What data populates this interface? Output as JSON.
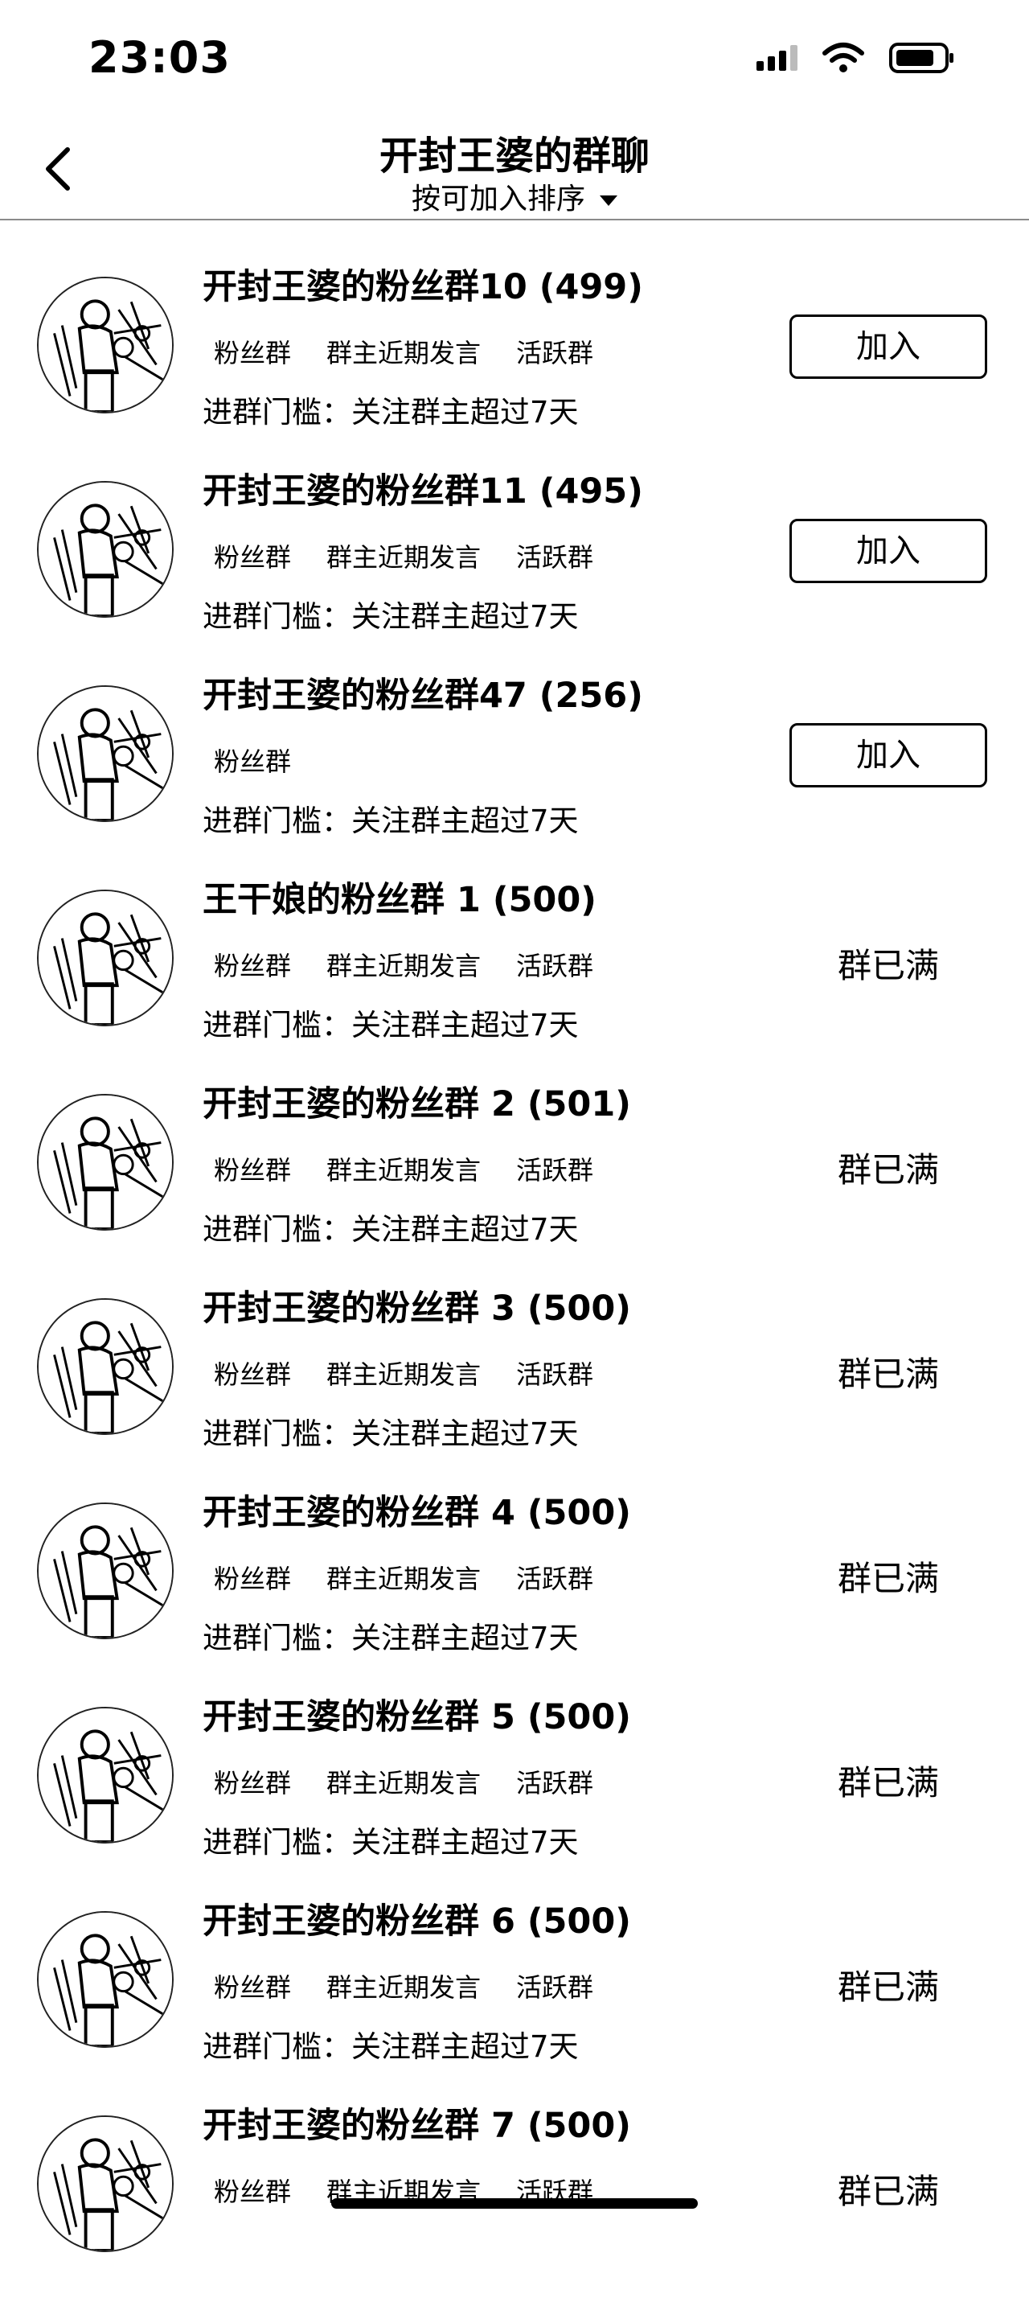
{
  "status_bar": {
    "time": "23:03"
  },
  "header": {
    "title": "开封王婆的群聊",
    "sort_label": "按可加入排序"
  },
  "groups": [
    {
      "name": "开封王婆的粉丝群10 (499)",
      "tags": [
        "粉丝群",
        "群主近期发言",
        "活跃群"
      ],
      "threshold": "进群门槛：关注群主超过7天",
      "action": "加入",
      "joinable": true
    },
    {
      "name": "开封王婆的粉丝群11 (495)",
      "tags": [
        "粉丝群",
        "群主近期发言",
        "活跃群"
      ],
      "threshold": "进群门槛：关注群主超过7天",
      "action": "加入",
      "joinable": true
    },
    {
      "name": "开封王婆的粉丝群47 (256)",
      "tags": [
        "粉丝群"
      ],
      "threshold": "进群门槛：关注群主超过7天",
      "action": "加入",
      "joinable": true
    },
    {
      "name": "王干娘的粉丝群 1 (500)",
      "tags": [
        "粉丝群",
        "群主近期发言",
        "活跃群"
      ],
      "threshold": "进群门槛：关注群主超过7天",
      "action": "群已满",
      "joinable": false
    },
    {
      "name": "开封王婆的粉丝群 2 (501)",
      "tags": [
        "粉丝群",
        "群主近期发言",
        "活跃群"
      ],
      "threshold": "进群门槛：关注群主超过7天",
      "action": "群已满",
      "joinable": false
    },
    {
      "name": "开封王婆的粉丝群 3 (500)",
      "tags": [
        "粉丝群",
        "群主近期发言",
        "活跃群"
      ],
      "threshold": "进群门槛：关注群主超过7天",
      "action": "群已满",
      "joinable": false
    },
    {
      "name": "开封王婆的粉丝群 4 (500)",
      "tags": [
        "粉丝群",
        "群主近期发言",
        "活跃群"
      ],
      "threshold": "进群门槛：关注群主超过7天",
      "action": "群已满",
      "joinable": false
    },
    {
      "name": "开封王婆的粉丝群 5 (500)",
      "tags": [
        "粉丝群",
        "群主近期发言",
        "活跃群"
      ],
      "threshold": "进群门槛：关注群主超过7天",
      "action": "群已满",
      "joinable": false
    },
    {
      "name": "开封王婆的粉丝群 6 (500)",
      "tags": [
        "粉丝群",
        "群主近期发言",
        "活跃群"
      ],
      "threshold": "进群门槛：关注群主超过7天",
      "action": "群已满",
      "joinable": false
    },
    {
      "name": "开封王婆的粉丝群 7 (500)",
      "tags": [
        "粉丝群",
        "群主近期发言",
        "活跃群"
      ],
      "threshold": "",
      "action": "群已满",
      "joinable": false
    }
  ]
}
